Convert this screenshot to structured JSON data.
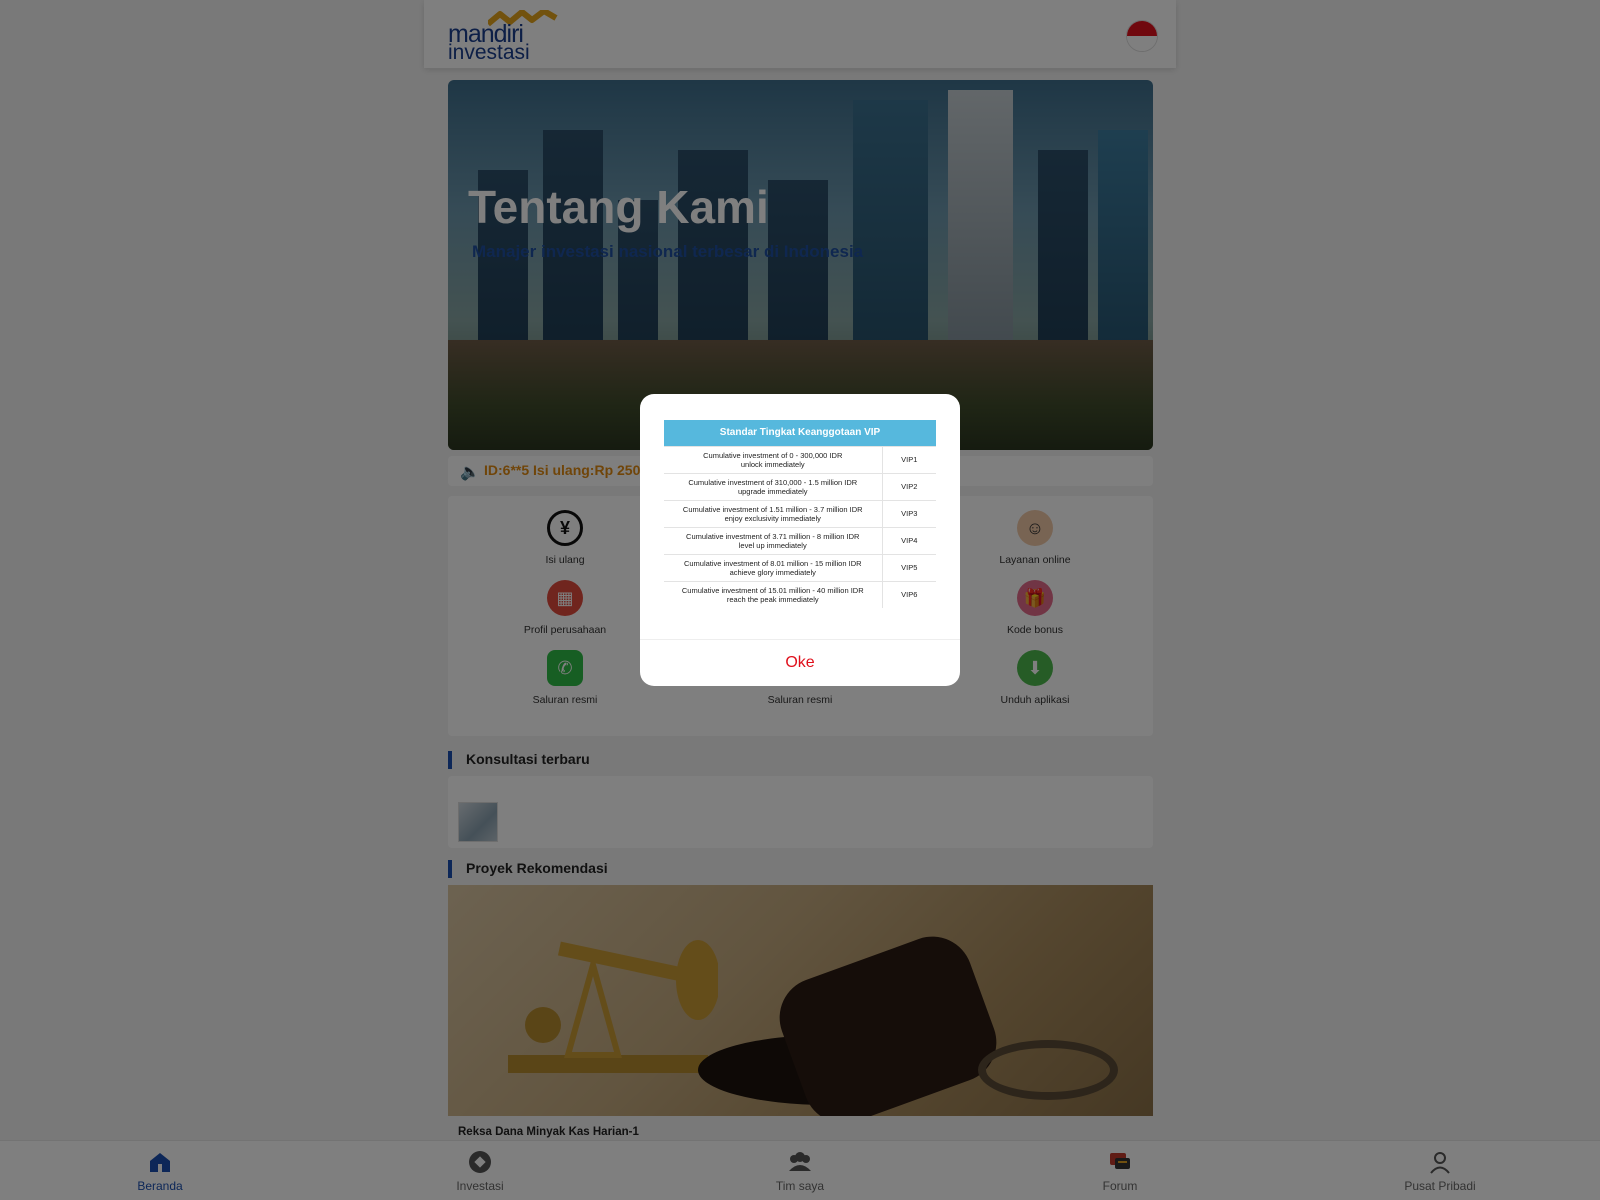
{
  "header": {
    "logo_top": "mandiri",
    "logo_bottom": "investasi",
    "flag": "indonesia-flag"
  },
  "banner": {
    "title": "Tentang Kami",
    "subtitle": "Manajer investasi nasional terbesar di Indonesia"
  },
  "marquee": {
    "text": "ID:6**5 Isi ulang:Rp 250"
  },
  "grid": {
    "items": [
      {
        "label": "Isi ulang",
        "icon": "yen-plus-icon"
      },
      {
        "label": "Layanan online",
        "icon": "customer-service-icon"
      },
      {
        "label": "Profil perusahaan",
        "icon": "building-icon"
      },
      {
        "label": "Kode bonus",
        "icon": "gift-icon"
      },
      {
        "label": "Saluran resmi",
        "icon": "whatsapp-icon"
      },
      {
        "label": "Saluran resmi",
        "icon": "channel-icon"
      },
      {
        "label": "Unduh aplikasi",
        "icon": "download-icon"
      }
    ]
  },
  "sections": {
    "consult_title": "Konsultasi terbaru",
    "project_title": "Proyek Rekomendasi"
  },
  "project": {
    "name": "Reksa Dana Minyak Kas Harian-1"
  },
  "modal": {
    "table_title": "Standar Tingkat Keanggotaan VIP",
    "rows": [
      {
        "line1": "Cumulative investment of 0 - 300,000 IDR",
        "line2": "unlock immediately",
        "level": "VIP1"
      },
      {
        "line1": "Cumulative investment of 310,000 - 1.5 million IDR",
        "line2": "upgrade immediately",
        "level": "VIP2"
      },
      {
        "line1": "Cumulative investment of 1.51 million - 3.7 million IDR",
        "line2": "enjoy exclusivity immediately",
        "level": "VIP3"
      },
      {
        "line1": "Cumulative investment of 3.71 million - 8 million IDR",
        "line2": "level up immediately",
        "level": "VIP4"
      },
      {
        "line1": "Cumulative investment of 8.01 million - 15 million IDR",
        "line2": "achieve glory immediately",
        "level": "VIP5"
      },
      {
        "line1": "Cumulative investment of 15.01 million - 40 million IDR",
        "line2": "reach the peak immediately",
        "level": "VIP6"
      }
    ],
    "ok_label": "Oke"
  },
  "bottom_nav": {
    "items": [
      {
        "label": "Beranda",
        "icon": "home-icon",
        "active": true
      },
      {
        "label": "Investasi",
        "icon": "investment-icon",
        "active": false
      },
      {
        "label": "Tim saya",
        "icon": "team-icon",
        "active": false
      },
      {
        "label": "Forum",
        "icon": "forum-icon",
        "active": false
      },
      {
        "label": "Pusat Pribadi",
        "icon": "user-icon",
        "active": false
      }
    ]
  },
  "colors": {
    "brand_blue": "#1b4fb0",
    "accent_red": "#e0101c",
    "marquee_orange": "#e08a12",
    "table_header": "#56b8dd"
  }
}
